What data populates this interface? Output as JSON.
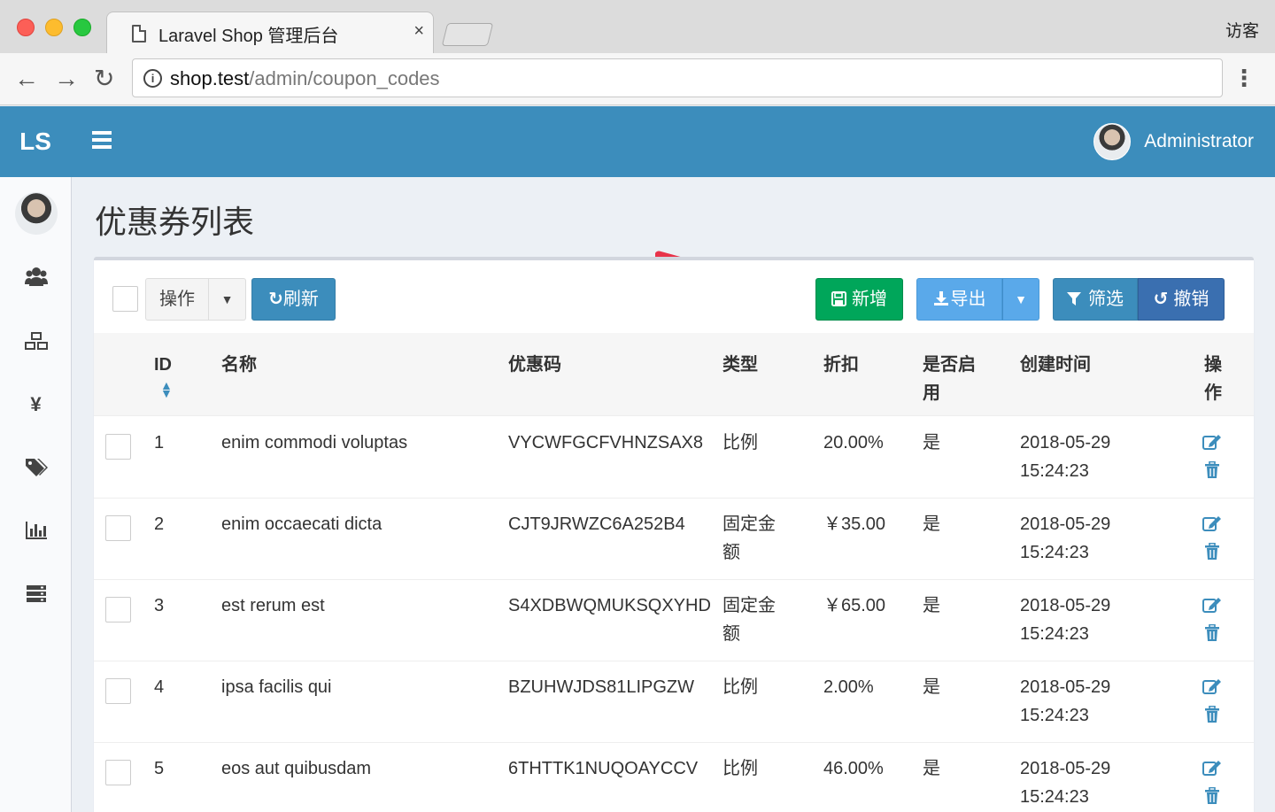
{
  "browser": {
    "tab_title": "Laravel Shop 管理后台",
    "tab_close": "×",
    "profile": "访客",
    "url_host": "shop.test",
    "url_path": "/admin/coupon_codes"
  },
  "header": {
    "logo": "LS",
    "user_name": "Administrator",
    "color": "#3c8dbc"
  },
  "sidebar": {
    "icons": [
      "users-icon",
      "cubes-icon",
      "yen-icon",
      "tags-icon",
      "bar-chart-icon",
      "server-icon"
    ],
    "yen_glyph": "¥"
  },
  "page": {
    "title": "优惠券列表"
  },
  "toolbar": {
    "ops_label": "操作",
    "refresh_label": "刷新",
    "new_label": "新增",
    "export_label": "导出",
    "filter_label": "筛选",
    "reset_label": "撤销"
  },
  "table": {
    "headers": {
      "id": "ID",
      "name": "名称",
      "code": "优惠码",
      "type": "类型",
      "discount": "折扣",
      "enabled_1": "是否启",
      "enabled_2": "用",
      "created": "创建时间",
      "action_1": "操",
      "action_2": "作"
    },
    "rows": [
      {
        "id": "1",
        "name": "enim commodi voluptas",
        "code": "VYCWFGCFVHNZSAX8",
        "type_1": "比例",
        "type_2": "",
        "discount": "20.00%",
        "enabled": "是",
        "date": "2018-05-29",
        "time": "15:24:23"
      },
      {
        "id": "2",
        "name": "enim occaecati dicta",
        "code": "CJT9JRWZC6A252B4",
        "type_1": "固定金",
        "type_2": "额",
        "discount": "￥35.00",
        "enabled": "是",
        "date": "2018-05-29",
        "time": "15:24:23"
      },
      {
        "id": "3",
        "name": "est rerum est",
        "code": "S4XDBWQMUKSQXYHD",
        "type_1": "固定金",
        "type_2": "额",
        "discount": "￥65.00",
        "enabled": "是",
        "date": "2018-05-29",
        "time": "15:24:23"
      },
      {
        "id": "4",
        "name": "ipsa facilis qui",
        "code": "BZUHWJDS81LIPGZW",
        "type_1": "比例",
        "type_2": "",
        "discount": "2.00%",
        "enabled": "是",
        "date": "2018-05-29",
        "time": "15:24:23"
      },
      {
        "id": "5",
        "name": "eos aut quibusdam",
        "code": "6THTTK1NUQOAYCCV",
        "type_1": "比例",
        "type_2": "",
        "discount": "46.00%",
        "enabled": "是",
        "date": "2018-05-29",
        "time": "15:24:23"
      }
    ]
  }
}
